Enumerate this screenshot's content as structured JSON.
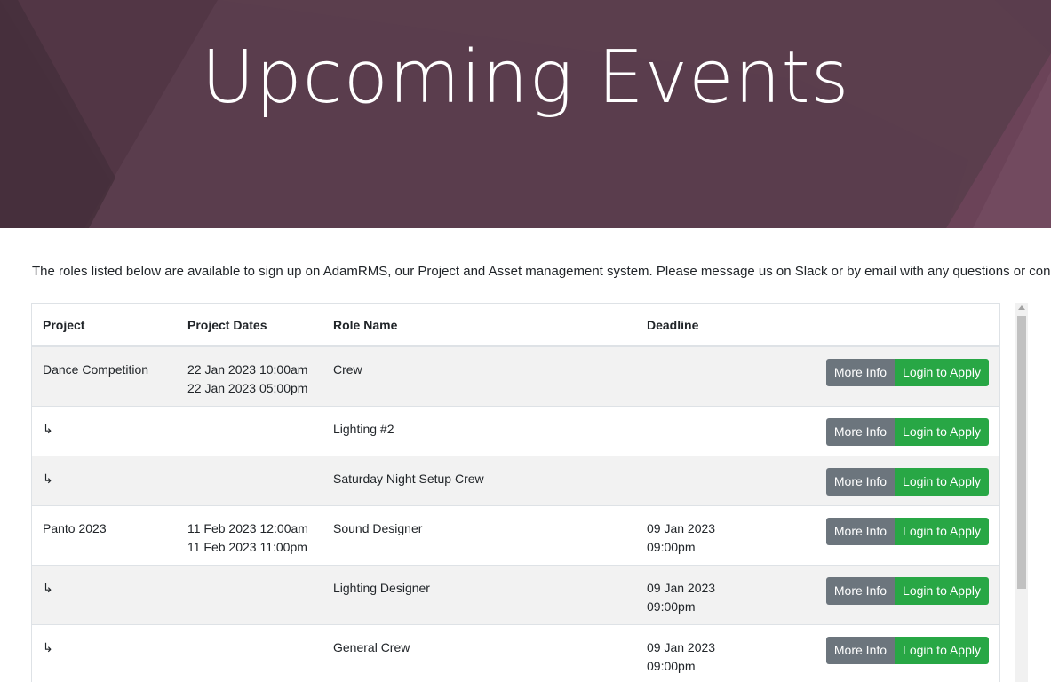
{
  "hero": {
    "title": "Upcoming Events"
  },
  "intro": "The roles listed below are available to sign up on AdamRMS, our Project and Asset management system. Please message us on Slack or by email with any questions or concerns",
  "table": {
    "headers": {
      "project": "Project",
      "dates": "Project Dates",
      "role": "Role Name",
      "deadline": "Deadline"
    },
    "more_info_label": "More Info",
    "apply_label": "Login to Apply",
    "rows": [
      {
        "project": "Dance Competition",
        "dates_start": "22 Jan 2023 10:00am",
        "dates_end": "22 Jan 2023 05:00pm",
        "role": "Crew",
        "deadline_date": "",
        "deadline_time": ""
      },
      {
        "project": "↳",
        "dates_start": "",
        "dates_end": "",
        "role": "Lighting #2",
        "deadline_date": "",
        "deadline_time": ""
      },
      {
        "project": "↳",
        "dates_start": "",
        "dates_end": "",
        "role": "Saturday Night Setup Crew",
        "deadline_date": "",
        "deadline_time": ""
      },
      {
        "project": "Panto 2023",
        "dates_start": "11 Feb 2023 12:00am",
        "dates_end": "11 Feb 2023 11:00pm",
        "role": "Sound Designer",
        "deadline_date": "09 Jan 2023",
        "deadline_time": "09:00pm"
      },
      {
        "project": "↳",
        "dates_start": "",
        "dates_end": "",
        "role": "Lighting Designer",
        "deadline_date": "09 Jan 2023",
        "deadline_time": "09:00pm"
      },
      {
        "project": "↳",
        "dates_start": "",
        "dates_end": "",
        "role": "General Crew",
        "deadline_date": "09 Jan 2023",
        "deadline_time": "09:00pm"
      }
    ]
  },
  "colors": {
    "hero_bg": "#5a3d4d",
    "btn_secondary": "#6c757d",
    "btn_success": "#28a745",
    "row_stripe": "#f2f2f2"
  }
}
